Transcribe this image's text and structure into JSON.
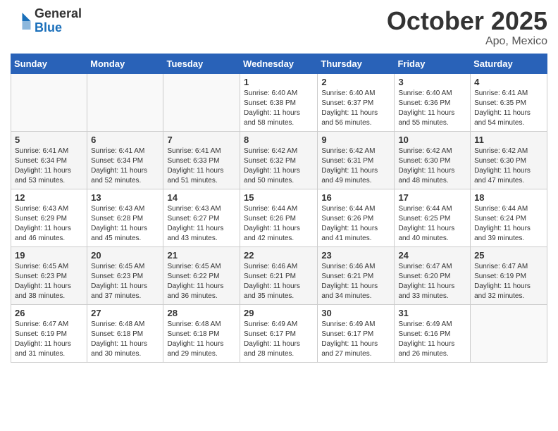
{
  "header": {
    "logo_general": "General",
    "logo_blue": "Blue",
    "title": "October 2025",
    "location": "Apo, Mexico"
  },
  "weekdays": [
    "Sunday",
    "Monday",
    "Tuesday",
    "Wednesday",
    "Thursday",
    "Friday",
    "Saturday"
  ],
  "weeks": [
    [
      {
        "day": "",
        "info": ""
      },
      {
        "day": "",
        "info": ""
      },
      {
        "day": "",
        "info": ""
      },
      {
        "day": "1",
        "info": "Sunrise: 6:40 AM\nSunset: 6:38 PM\nDaylight: 11 hours\nand 58 minutes."
      },
      {
        "day": "2",
        "info": "Sunrise: 6:40 AM\nSunset: 6:37 PM\nDaylight: 11 hours\nand 56 minutes."
      },
      {
        "day": "3",
        "info": "Sunrise: 6:40 AM\nSunset: 6:36 PM\nDaylight: 11 hours\nand 55 minutes."
      },
      {
        "day": "4",
        "info": "Sunrise: 6:41 AM\nSunset: 6:35 PM\nDaylight: 11 hours\nand 54 minutes."
      }
    ],
    [
      {
        "day": "5",
        "info": "Sunrise: 6:41 AM\nSunset: 6:34 PM\nDaylight: 11 hours\nand 53 minutes."
      },
      {
        "day": "6",
        "info": "Sunrise: 6:41 AM\nSunset: 6:34 PM\nDaylight: 11 hours\nand 52 minutes."
      },
      {
        "day": "7",
        "info": "Sunrise: 6:41 AM\nSunset: 6:33 PM\nDaylight: 11 hours\nand 51 minutes."
      },
      {
        "day": "8",
        "info": "Sunrise: 6:42 AM\nSunset: 6:32 PM\nDaylight: 11 hours\nand 50 minutes."
      },
      {
        "day": "9",
        "info": "Sunrise: 6:42 AM\nSunset: 6:31 PM\nDaylight: 11 hours\nand 49 minutes."
      },
      {
        "day": "10",
        "info": "Sunrise: 6:42 AM\nSunset: 6:30 PM\nDaylight: 11 hours\nand 48 minutes."
      },
      {
        "day": "11",
        "info": "Sunrise: 6:42 AM\nSunset: 6:30 PM\nDaylight: 11 hours\nand 47 minutes."
      }
    ],
    [
      {
        "day": "12",
        "info": "Sunrise: 6:43 AM\nSunset: 6:29 PM\nDaylight: 11 hours\nand 46 minutes."
      },
      {
        "day": "13",
        "info": "Sunrise: 6:43 AM\nSunset: 6:28 PM\nDaylight: 11 hours\nand 45 minutes."
      },
      {
        "day": "14",
        "info": "Sunrise: 6:43 AM\nSunset: 6:27 PM\nDaylight: 11 hours\nand 43 minutes."
      },
      {
        "day": "15",
        "info": "Sunrise: 6:44 AM\nSunset: 6:26 PM\nDaylight: 11 hours\nand 42 minutes."
      },
      {
        "day": "16",
        "info": "Sunrise: 6:44 AM\nSunset: 6:26 PM\nDaylight: 11 hours\nand 41 minutes."
      },
      {
        "day": "17",
        "info": "Sunrise: 6:44 AM\nSunset: 6:25 PM\nDaylight: 11 hours\nand 40 minutes."
      },
      {
        "day": "18",
        "info": "Sunrise: 6:44 AM\nSunset: 6:24 PM\nDaylight: 11 hours\nand 39 minutes."
      }
    ],
    [
      {
        "day": "19",
        "info": "Sunrise: 6:45 AM\nSunset: 6:23 PM\nDaylight: 11 hours\nand 38 minutes."
      },
      {
        "day": "20",
        "info": "Sunrise: 6:45 AM\nSunset: 6:23 PM\nDaylight: 11 hours\nand 37 minutes."
      },
      {
        "day": "21",
        "info": "Sunrise: 6:45 AM\nSunset: 6:22 PM\nDaylight: 11 hours\nand 36 minutes."
      },
      {
        "day": "22",
        "info": "Sunrise: 6:46 AM\nSunset: 6:21 PM\nDaylight: 11 hours\nand 35 minutes."
      },
      {
        "day": "23",
        "info": "Sunrise: 6:46 AM\nSunset: 6:21 PM\nDaylight: 11 hours\nand 34 minutes."
      },
      {
        "day": "24",
        "info": "Sunrise: 6:47 AM\nSunset: 6:20 PM\nDaylight: 11 hours\nand 33 minutes."
      },
      {
        "day": "25",
        "info": "Sunrise: 6:47 AM\nSunset: 6:19 PM\nDaylight: 11 hours\nand 32 minutes."
      }
    ],
    [
      {
        "day": "26",
        "info": "Sunrise: 6:47 AM\nSunset: 6:19 PM\nDaylight: 11 hours\nand 31 minutes."
      },
      {
        "day": "27",
        "info": "Sunrise: 6:48 AM\nSunset: 6:18 PM\nDaylight: 11 hours\nand 30 minutes."
      },
      {
        "day": "28",
        "info": "Sunrise: 6:48 AM\nSunset: 6:18 PM\nDaylight: 11 hours\nand 29 minutes."
      },
      {
        "day": "29",
        "info": "Sunrise: 6:49 AM\nSunset: 6:17 PM\nDaylight: 11 hours\nand 28 minutes."
      },
      {
        "day": "30",
        "info": "Sunrise: 6:49 AM\nSunset: 6:17 PM\nDaylight: 11 hours\nand 27 minutes."
      },
      {
        "day": "31",
        "info": "Sunrise: 6:49 AM\nSunset: 6:16 PM\nDaylight: 11 hours\nand 26 minutes."
      },
      {
        "day": "",
        "info": ""
      }
    ]
  ]
}
